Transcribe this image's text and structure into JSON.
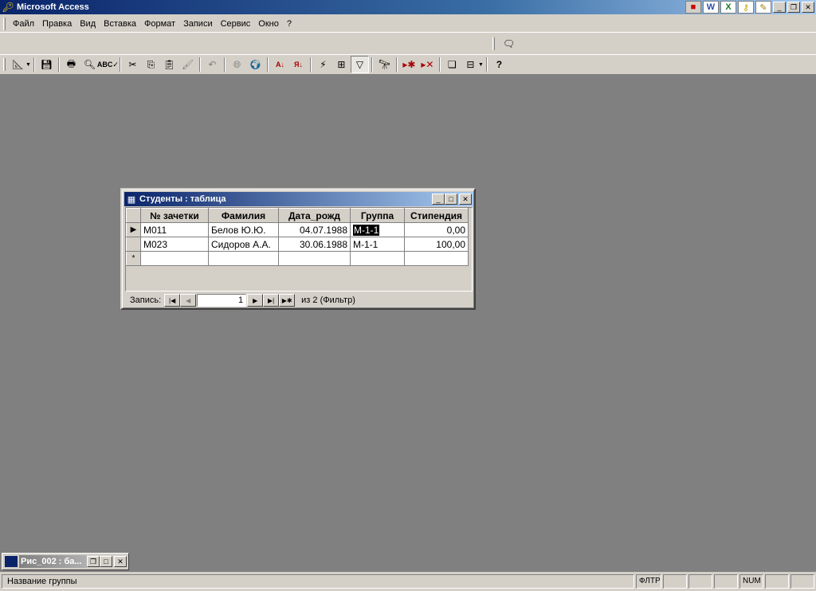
{
  "app": {
    "title": "Microsoft Access"
  },
  "menu": [
    {
      "label": "Файл"
    },
    {
      "label": "Правка"
    },
    {
      "label": "Вид"
    },
    {
      "label": "Вставка"
    },
    {
      "label": "Формат"
    },
    {
      "label": "Записи"
    },
    {
      "label": "Сервис"
    },
    {
      "label": "Окно"
    },
    {
      "label": "?"
    }
  ],
  "table_window": {
    "title": "Студенты : таблица",
    "columns": [
      "№ зачетки",
      "Фамилия",
      "Дата_рожд",
      "Группа",
      "Стипендия"
    ],
    "rows": [
      {
        "id": "М011",
        "name": "Белов Ю.Ю.",
        "dob": "04.07.1988",
        "group": "М-1-1",
        "stipend": "0,00"
      },
      {
        "id": "М023",
        "name": "Сидоров А.А.",
        "dob": "30.06.1988",
        "group": "М-1-1",
        "stipend": "100,00"
      }
    ],
    "new_row_marker": "*",
    "current_row_marker": "▶",
    "nav": {
      "label": "Запись:",
      "current": "1",
      "of_text": "из  2 (Фильтр)"
    }
  },
  "minimized_window": {
    "title": "Рис_002 : ба..."
  },
  "status": {
    "text": "Название группы",
    "indicators": [
      "ФЛТР",
      "",
      "",
      "",
      "NUM",
      "",
      ""
    ]
  },
  "icons": [
    "key-icon",
    "save-icon",
    "print-icon",
    "print-preview-icon",
    "spelling-icon",
    "cut-icon",
    "copy-icon",
    "paste-icon",
    "format-painter-icon",
    "undo-icon",
    "hyperlink-icon",
    "web-icon",
    "sort-asc-icon",
    "sort-desc-icon",
    "filter-selection-icon",
    "filter-form-icon",
    "apply-filter-icon",
    "find-icon",
    "new-record-icon",
    "delete-record-icon",
    "database-window-icon",
    "new-object-icon",
    "help-icon"
  ]
}
